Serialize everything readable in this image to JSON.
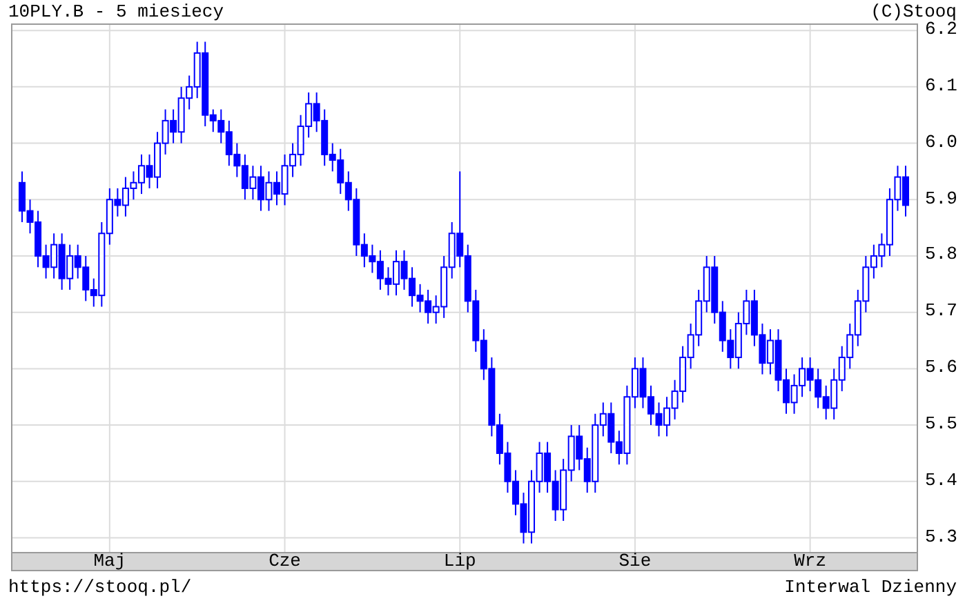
{
  "header": {
    "title": "10PLY.B - 5 miesiecy",
    "copyright": "(C)Stooq"
  },
  "chart": {
    "chart_data": {
      "type": "candlestick",
      "grid": true,
      "ylim": [
        5.27,
        6.21
      ],
      "yticks": [
        {
          "value": 6.2,
          "label": "6.2"
        },
        {
          "value": 6.1,
          "label": "6.1"
        },
        {
          "value": 6.0,
          "label": "6.0"
        },
        {
          "value": 5.9,
          "label": "5.9"
        },
        {
          "value": 5.8,
          "label": "5.8"
        },
        {
          "value": 5.7,
          "label": "5.7"
        },
        {
          "value": 5.6,
          "label": "5.6"
        },
        {
          "value": 5.5,
          "label": "5.5"
        },
        {
          "value": 5.4,
          "label": "5.4"
        },
        {
          "value": 5.3,
          "label": "5.3"
        }
      ],
      "categories": [
        null,
        null,
        null,
        null,
        null,
        null,
        null,
        null,
        null,
        null,
        null,
        "Maj",
        null,
        null,
        null,
        null,
        null,
        null,
        null,
        null,
        null,
        null,
        null,
        null,
        null,
        null,
        null,
        null,
        null,
        null,
        null,
        null,
        null,
        "Cze",
        null,
        null,
        null,
        null,
        null,
        null,
        null,
        null,
        null,
        null,
        null,
        null,
        null,
        null,
        null,
        null,
        null,
        null,
        null,
        null,
        null,
        "Lip",
        null,
        null,
        null,
        null,
        null,
        null,
        null,
        null,
        null,
        null,
        null,
        null,
        null,
        null,
        null,
        null,
        null,
        null,
        null,
        null,
        null,
        "Sie",
        null,
        null,
        null,
        null,
        null,
        null,
        null,
        null,
        null,
        null,
        null,
        null,
        null,
        null,
        null,
        null,
        null,
        null,
        null,
        null,
        null,
        "Wrz",
        null,
        null,
        null,
        null,
        null,
        null,
        null,
        null,
        null,
        null,
        null,
        null
      ],
      "ohlc": [
        [
          5.93,
          5.95,
          5.86,
          5.88
        ],
        [
          5.88,
          5.9,
          5.84,
          5.86
        ],
        [
          5.86,
          5.88,
          5.78,
          5.8
        ],
        [
          5.8,
          5.82,
          5.76,
          5.78
        ],
        [
          5.78,
          5.84,
          5.76,
          5.82
        ],
        [
          5.82,
          5.84,
          5.74,
          5.76
        ],
        [
          5.76,
          5.82,
          5.74,
          5.8
        ],
        [
          5.8,
          5.82,
          5.76,
          5.78
        ],
        [
          5.78,
          5.8,
          5.72,
          5.74
        ],
        [
          5.74,
          5.76,
          5.71,
          5.73
        ],
        [
          5.73,
          5.86,
          5.71,
          5.84
        ],
        [
          5.84,
          5.92,
          5.82,
          5.9
        ],
        [
          5.9,
          5.92,
          5.87,
          5.89
        ],
        [
          5.89,
          5.94,
          5.87,
          5.92
        ],
        [
          5.92,
          5.95,
          5.9,
          5.93
        ],
        [
          5.93,
          5.98,
          5.91,
          5.96
        ],
        [
          5.96,
          5.98,
          5.92,
          5.94
        ],
        [
          5.94,
          6.02,
          5.92,
          6.0
        ],
        [
          6.0,
          6.06,
          5.98,
          6.04
        ],
        [
          6.04,
          6.06,
          6.0,
          6.02
        ],
        [
          6.02,
          6.1,
          6.0,
          6.08
        ],
        [
          6.08,
          6.12,
          6.06,
          6.1
        ],
        [
          6.1,
          6.18,
          6.08,
          6.16
        ],
        [
          6.16,
          6.18,
          6.03,
          6.05
        ],
        [
          6.05,
          6.06,
          6.02,
          6.04
        ],
        [
          6.04,
          6.06,
          6.0,
          6.02
        ],
        [
          6.02,
          6.04,
          5.96,
          5.98
        ],
        [
          5.98,
          6.0,
          5.94,
          5.96
        ],
        [
          5.96,
          5.98,
          5.9,
          5.92
        ],
        [
          5.92,
          5.96,
          5.9,
          5.94
        ],
        [
          5.94,
          5.96,
          5.88,
          5.9
        ],
        [
          5.9,
          5.95,
          5.88,
          5.93
        ],
        [
          5.93,
          5.95,
          5.89,
          5.91
        ],
        [
          5.91,
          5.98,
          5.89,
          5.96
        ],
        [
          5.96,
          6.0,
          5.94,
          5.98
        ],
        [
          5.98,
          6.05,
          5.96,
          6.03
        ],
        [
          6.03,
          6.09,
          6.01,
          6.07
        ],
        [
          6.07,
          6.09,
          6.02,
          6.04
        ],
        [
          6.04,
          6.06,
          5.96,
          5.98
        ],
        [
          5.98,
          6.0,
          5.95,
          5.97
        ],
        [
          5.97,
          5.99,
          5.91,
          5.93
        ],
        [
          5.93,
          5.95,
          5.88,
          5.9
        ],
        [
          5.9,
          5.92,
          5.8,
          5.82
        ],
        [
          5.82,
          5.84,
          5.78,
          5.8
        ],
        [
          5.8,
          5.82,
          5.77,
          5.79
        ],
        [
          5.79,
          5.81,
          5.74,
          5.76
        ],
        [
          5.76,
          5.78,
          5.73,
          5.75
        ],
        [
          5.75,
          5.81,
          5.73,
          5.79
        ],
        [
          5.79,
          5.81,
          5.74,
          5.76
        ],
        [
          5.76,
          5.78,
          5.71,
          5.73
        ],
        [
          5.73,
          5.75,
          5.7,
          5.72
        ],
        [
          5.72,
          5.74,
          5.68,
          5.7
        ],
        [
          5.7,
          5.73,
          5.68,
          5.71
        ],
        [
          5.71,
          5.8,
          5.69,
          5.78
        ],
        [
          5.78,
          5.86,
          5.76,
          5.84
        ],
        [
          5.84,
          5.95,
          5.78,
          5.8
        ],
        [
          5.8,
          5.82,
          5.7,
          5.72
        ],
        [
          5.72,
          5.74,
          5.63,
          5.65
        ],
        [
          5.65,
          5.67,
          5.58,
          5.6
        ],
        [
          5.6,
          5.62,
          5.48,
          5.5
        ],
        [
          5.5,
          5.52,
          5.43,
          5.45
        ],
        [
          5.45,
          5.47,
          5.38,
          5.4
        ],
        [
          5.4,
          5.42,
          5.34,
          5.36
        ],
        [
          5.36,
          5.38,
          5.29,
          5.31
        ],
        [
          5.31,
          5.42,
          5.29,
          5.4
        ],
        [
          5.4,
          5.47,
          5.38,
          5.45
        ],
        [
          5.45,
          5.47,
          5.38,
          5.4
        ],
        [
          5.4,
          5.42,
          5.33,
          5.35
        ],
        [
          5.35,
          5.44,
          5.33,
          5.42
        ],
        [
          5.42,
          5.5,
          5.4,
          5.48
        ],
        [
          5.48,
          5.5,
          5.42,
          5.44
        ],
        [
          5.44,
          5.46,
          5.38,
          5.4
        ],
        [
          5.4,
          5.52,
          5.38,
          5.5
        ],
        [
          5.5,
          5.54,
          5.48,
          5.52
        ],
        [
          5.52,
          5.54,
          5.45,
          5.47
        ],
        [
          5.47,
          5.49,
          5.43,
          5.45
        ],
        [
          5.45,
          5.57,
          5.43,
          5.55
        ],
        [
          5.55,
          5.62,
          5.53,
          5.6
        ],
        [
          5.6,
          5.62,
          5.53,
          5.55
        ],
        [
          5.55,
          5.57,
          5.5,
          5.52
        ],
        [
          5.52,
          5.54,
          5.48,
          5.5
        ],
        [
          5.5,
          5.55,
          5.48,
          5.53
        ],
        [
          5.53,
          5.58,
          5.51,
          5.56
        ],
        [
          5.56,
          5.64,
          5.54,
          5.62
        ],
        [
          5.62,
          5.68,
          5.6,
          5.66
        ],
        [
          5.66,
          5.74,
          5.64,
          5.72
        ],
        [
          5.72,
          5.8,
          5.7,
          5.78
        ],
        [
          5.78,
          5.8,
          5.68,
          5.7
        ],
        [
          5.7,
          5.72,
          5.63,
          5.65
        ],
        [
          5.65,
          5.67,
          5.6,
          5.62
        ],
        [
          5.62,
          5.7,
          5.6,
          5.68
        ],
        [
          5.68,
          5.74,
          5.66,
          5.72
        ],
        [
          5.72,
          5.74,
          5.64,
          5.66
        ],
        [
          5.66,
          5.68,
          5.59,
          5.61
        ],
        [
          5.61,
          5.67,
          5.59,
          5.65
        ],
        [
          5.65,
          5.67,
          5.56,
          5.58
        ],
        [
          5.58,
          5.6,
          5.52,
          5.54
        ],
        [
          5.54,
          5.59,
          5.52,
          5.57
        ],
        [
          5.57,
          5.62,
          5.55,
          5.6
        ],
        [
          5.6,
          5.62,
          5.56,
          5.58
        ],
        [
          5.58,
          5.6,
          5.53,
          5.55
        ],
        [
          5.55,
          5.57,
          5.51,
          5.53
        ],
        [
          5.53,
          5.6,
          5.51,
          5.58
        ],
        [
          5.58,
          5.64,
          5.56,
          5.62
        ],
        [
          5.62,
          5.68,
          5.6,
          5.66
        ],
        [
          5.66,
          5.74,
          5.64,
          5.72
        ],
        [
          5.72,
          5.8,
          5.7,
          5.78
        ],
        [
          5.78,
          5.82,
          5.76,
          5.8
        ],
        [
          5.8,
          5.84,
          5.78,
          5.82
        ],
        [
          5.82,
          5.92,
          5.8,
          5.9
        ],
        [
          5.9,
          5.96,
          5.88,
          5.94
        ],
        [
          5.94,
          5.96,
          5.87,
          5.89
        ]
      ]
    }
  },
  "footer": {
    "url": "https://stooq.pl/",
    "interval": "Interwal Dzienny"
  }
}
